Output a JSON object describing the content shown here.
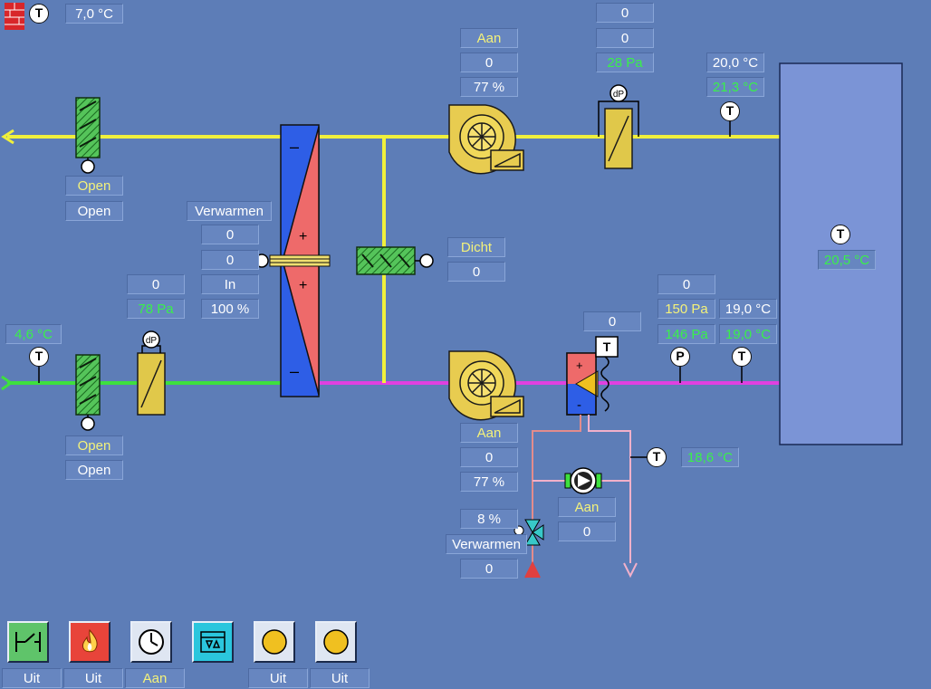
{
  "outside": {
    "temp": "7,0 °C"
  },
  "exhaust_damper": {
    "state1": "Open",
    "state2": "Open"
  },
  "intake": {
    "temp": "4,6 °C"
  },
  "intake_damper": {
    "state1": "Open",
    "state2": "Open"
  },
  "intake_filter": {
    "setpoint": "0",
    "pressure": "78 Pa"
  },
  "heat_recovery": {
    "mode": "Verwarmen",
    "val1": "0",
    "val2": "0",
    "direction": "In",
    "percent": "100 %"
  },
  "bypass_damper": {
    "state": "Dicht",
    "value": "0"
  },
  "exhaust_fan": {
    "status": "Aan",
    "value": "0",
    "percent": "77 %"
  },
  "exhaust_filter": {
    "value1": "0",
    "value2": "0",
    "pressure": "28 Pa"
  },
  "extract": {
    "setpoint": "20,0 °C",
    "temp": "21,3 °C"
  },
  "room": {
    "temp": "20,5 °C"
  },
  "supply_fan": {
    "status": "Aan",
    "value": "0",
    "percent": "77 %"
  },
  "coil": {
    "value": "0"
  },
  "supply_pressure": {
    "value": "0",
    "setpoint": "150 Pa",
    "actual": "146 Pa"
  },
  "supply_temp": {
    "setpoint": "19,0 °C",
    "actual": "19,0 °C"
  },
  "water": {
    "temp": "18,6 °C"
  },
  "pump": {
    "status": "Aan",
    "value": "0"
  },
  "valve": {
    "percent": "8 %",
    "mode": "Verwarmen",
    "value": "0"
  },
  "buttons": [
    {
      "label": "Uit",
      "icon": "switch-icon",
      "color": "#5fc46a"
    },
    {
      "label": "Uit",
      "icon": "fire-icon",
      "color": "#e8443a"
    },
    {
      "label": "Aan",
      "icon": "clock-icon",
      "color": "#dfe6f2"
    },
    {
      "label": "",
      "icon": "valve-control-icon",
      "color": "#2bc6dd"
    },
    {
      "label": "Uit",
      "icon": "indicator-lamp-icon",
      "color": "#dfe6f2"
    },
    {
      "label": "Uit",
      "icon": "indicator-lamp-icon",
      "color": "#dfe6f2"
    }
  ],
  "colors": {
    "background": "#5d7db7",
    "duct_yellow": "#f0f03c",
    "duct_green": "#3ee03e",
    "duct_magenta": "#e040e0",
    "value_yellow": "#f4f27a",
    "value_green": "#39f04a"
  }
}
